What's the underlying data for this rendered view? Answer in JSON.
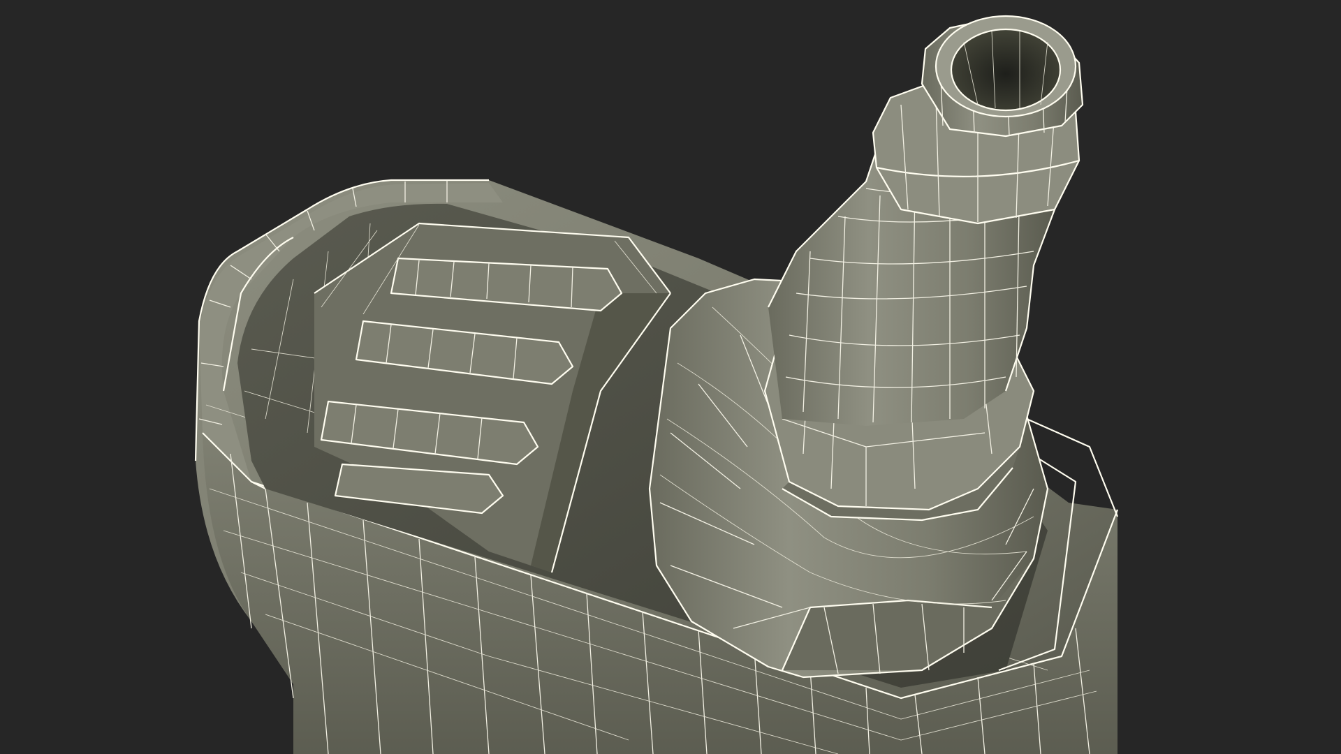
{
  "scene": {
    "subject": "wireframe-3d-model",
    "colors": {
      "background": "#262626",
      "surface_light": "#8a8b7c",
      "surface_mid": "#6c6d60",
      "surface_dark": "#4a4b42",
      "wire": "#f3f1e4"
    }
  }
}
